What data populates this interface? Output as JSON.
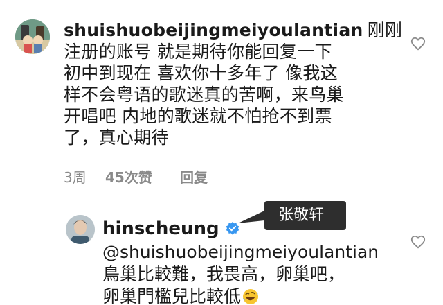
{
  "comment": {
    "username": "shuishuobeijingmeiyoulantian",
    "text_lines": [
      "刚刚",
      "注册的账号 就是期待你能回复一下",
      "初中到现在 喜欢你十多年了 像我这",
      "样不会粤语的歌迷真的苦啊，来鸟巢",
      "开唱吧 内地的歌迷就不怕抢不到票",
      "了，真心期待"
    ],
    "time": "3周",
    "likes": "45次赞",
    "reply_label": "回复"
  },
  "callout": {
    "label": "张敬轩"
  },
  "reply": {
    "username": "hinscheung",
    "mention": "@shuishuobeijingmeiyoulantian",
    "text_lines": [
      "鳥巢比較難，我畏高，卵巢吧，",
      "卵巢門檻兒比較低"
    ]
  },
  "icons": {
    "heart": "heart-outline-icon",
    "verified": "verified-badge-icon",
    "emoji": "rofl-emoji-icon"
  },
  "colors": {
    "verified_blue": "#3897f0",
    "callout_bg": "#2e2e2e",
    "meta_gray": "#8a8a8a"
  }
}
